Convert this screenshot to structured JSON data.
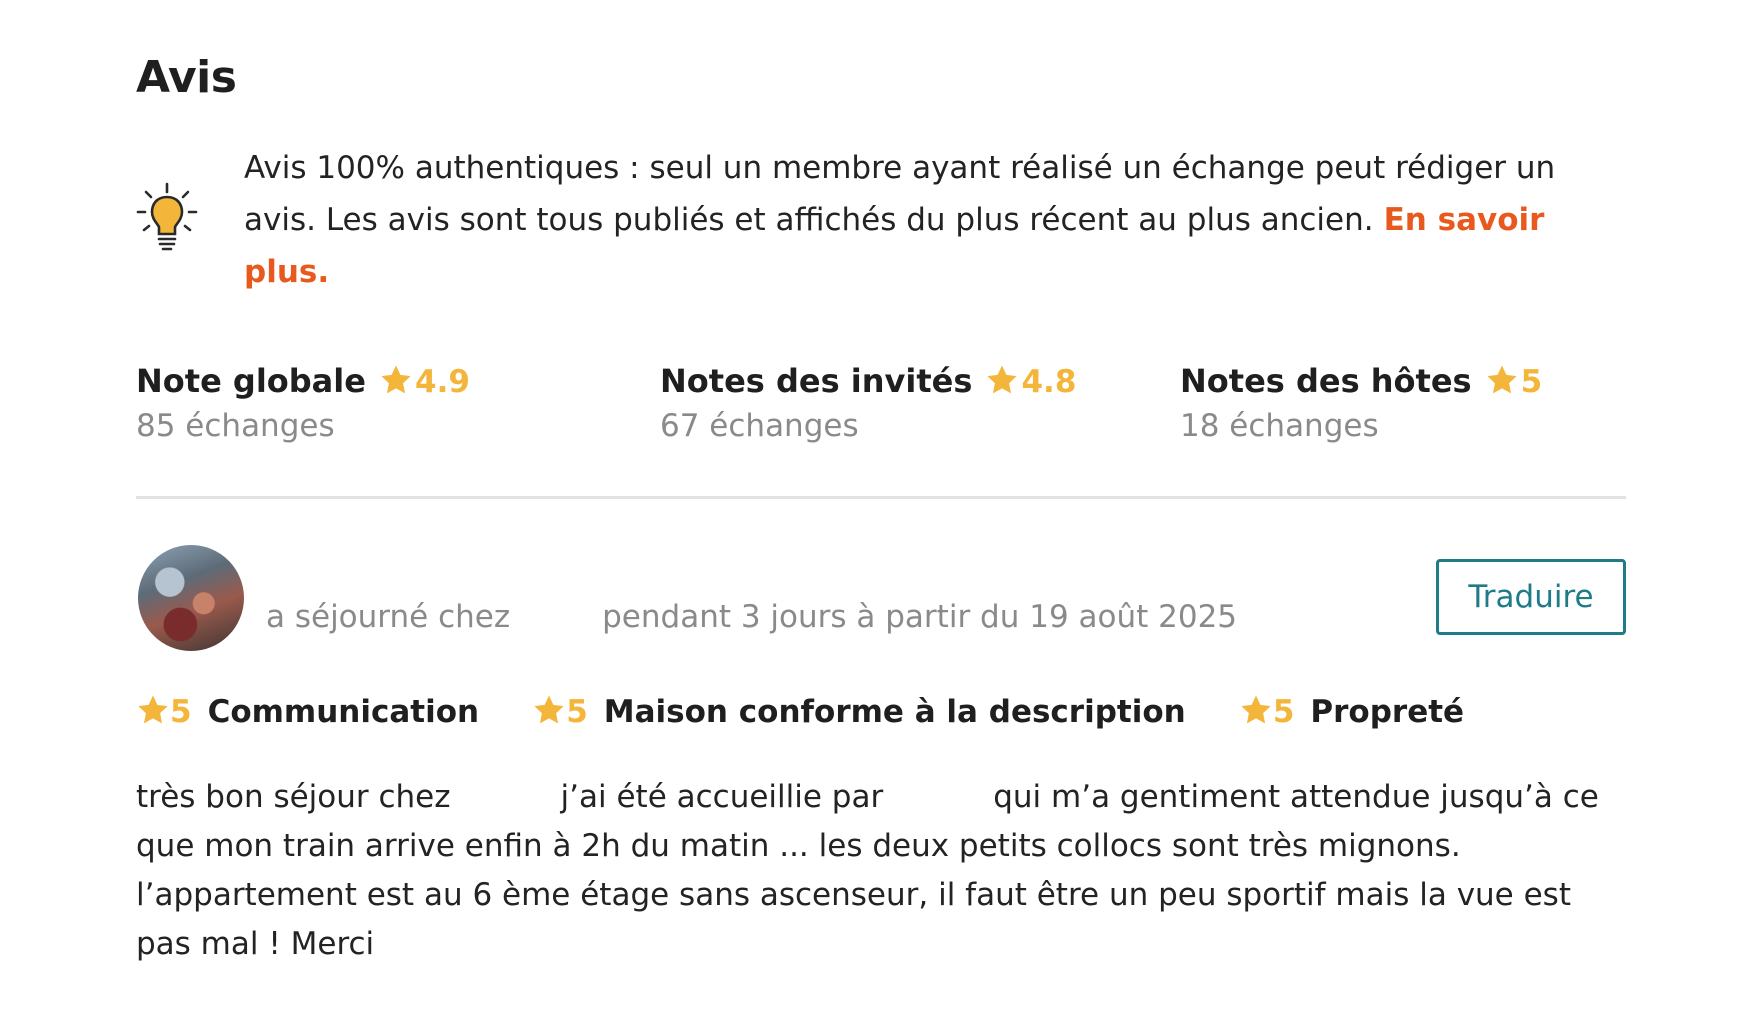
{
  "section": {
    "title": "Avis"
  },
  "info": {
    "icon": "lightbulb-icon",
    "text": "Avis 100% authentiques : seul un membre ayant réalisé un échange peut rédiger un avis. Les avis sont tous publiés et affichés du plus récent au plus ancien.",
    "link": "En savoir plus."
  },
  "colors": {
    "accent": "#e8591e",
    "star": "#f4b63a",
    "teal": "#1f7b88",
    "muted": "#8a8a8a"
  },
  "ratings": [
    {
      "label": "Note globale",
      "score": "4.9",
      "count": "85 échanges"
    },
    {
      "label": "Notes des invités",
      "score": "4.8",
      "count": "67 échanges"
    },
    {
      "label": "Notes des hôtes",
      "score": "5",
      "count": "18 échanges"
    }
  ],
  "review": {
    "stay_prefix": "a séjourné chez",
    "stay_period": "pendant 3 jours à partir du 19 août 2025",
    "translate_label": "Traduire",
    "criteria": [
      {
        "score": "5",
        "label": "Communication"
      },
      {
        "score": "5",
        "label": "Maison conforme à la description"
      },
      {
        "score": "5",
        "label": "Propreté"
      }
    ],
    "text_parts": [
      "très bon séjour chez",
      "j’ai été accueillie par",
      "qui m’a gentiment attendue jusqu’à ce que mon train arrive enfin à 2h du matin ... les deux petits collocs sont très mignons. l’appartement est au 6 ème étage sans ascenseur, il faut être un peu sportif mais la vue est pas mal ! Merci"
    ]
  }
}
